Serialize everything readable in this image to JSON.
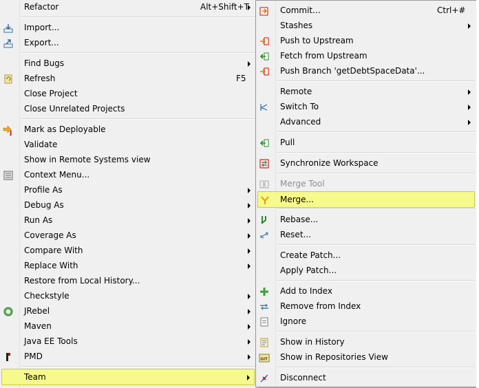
{
  "main_menu": {
    "items": [
      {
        "label": "Refactor",
        "shortcut": "Alt+Shift+T",
        "submenu": true
      },
      {
        "label": "Import...",
        "icon": "import-icon"
      },
      {
        "label": "Export...",
        "icon": "export-icon"
      },
      {
        "label": "Find Bugs",
        "submenu": true
      },
      {
        "label": "Refresh",
        "shortcut": "F5",
        "icon": "refresh-icon"
      },
      {
        "label": "Close Project"
      },
      {
        "label": "Close Unrelated Projects"
      },
      {
        "label": "Mark as Deployable",
        "icon": "jrebel-deploy-icon"
      },
      {
        "label": "Validate"
      },
      {
        "label": "Show in Remote Systems view"
      },
      {
        "label": "Context Menu...",
        "icon": "context-menu-icon"
      },
      {
        "label": "Profile As",
        "submenu": true
      },
      {
        "label": "Debug As",
        "submenu": true
      },
      {
        "label": "Run As",
        "submenu": true
      },
      {
        "label": "Coverage As",
        "submenu": true
      },
      {
        "label": "Compare With",
        "submenu": true
      },
      {
        "label": "Replace With",
        "submenu": true
      },
      {
        "label": "Restore from Local History..."
      },
      {
        "label": "Checkstyle",
        "submenu": true
      },
      {
        "label": "JRebel",
        "submenu": true,
        "icon": "jrebel-icon"
      },
      {
        "label": "Maven",
        "submenu": true
      },
      {
        "label": "Java EE Tools",
        "submenu": true
      },
      {
        "label": "PMD",
        "submenu": true,
        "icon": "pmd-icon"
      },
      {
        "label": "Team",
        "submenu": true,
        "highlighted": true
      }
    ]
  },
  "team_submenu": {
    "items": [
      {
        "label": "Commit...",
        "shortcut": "Ctrl+#",
        "icon": "commit-icon"
      },
      {
        "label": "Stashes",
        "submenu": true
      },
      {
        "label": "Push to Upstream",
        "icon": "push-icon"
      },
      {
        "label": "Fetch from Upstream",
        "icon": "fetch-icon"
      },
      {
        "label": "Push Branch 'getDebtSpaceData'...",
        "icon": "push-branch-icon"
      },
      {
        "label": "Remote",
        "submenu": true
      },
      {
        "label": "Switch To",
        "submenu": true,
        "icon": "switch-branch-icon"
      },
      {
        "label": "Advanced",
        "submenu": true
      },
      {
        "label": "Pull",
        "icon": "pull-icon"
      },
      {
        "label": "Synchronize Workspace",
        "icon": "synchronize-icon"
      },
      {
        "label": "Merge Tool",
        "disabled": true,
        "icon": "merge-tool-icon"
      },
      {
        "label": "Merge...",
        "highlighted": true,
        "icon": "merge-icon"
      },
      {
        "label": "Rebase...",
        "icon": "rebase-icon"
      },
      {
        "label": "Reset...",
        "icon": "reset-icon"
      },
      {
        "label": "Create Patch..."
      },
      {
        "label": "Apply Patch..."
      },
      {
        "label": "Add to Index",
        "icon": "add-icon"
      },
      {
        "label": "Remove from Index",
        "icon": "remove-from-index-icon"
      },
      {
        "label": "Ignore",
        "icon": "ignore-icon"
      },
      {
        "label": "Show in History",
        "icon": "history-icon"
      },
      {
        "label": "Show in Repositories View",
        "icon": "git-repositories-icon"
      },
      {
        "label": "Disconnect",
        "icon": "disconnect-icon"
      }
    ]
  },
  "colors": {
    "menu_bg": "#f0f0f0",
    "highlight_bg": "#f6f98b",
    "highlight_border": "#c7cb4a",
    "disabled_text": "#8d8d8d"
  }
}
